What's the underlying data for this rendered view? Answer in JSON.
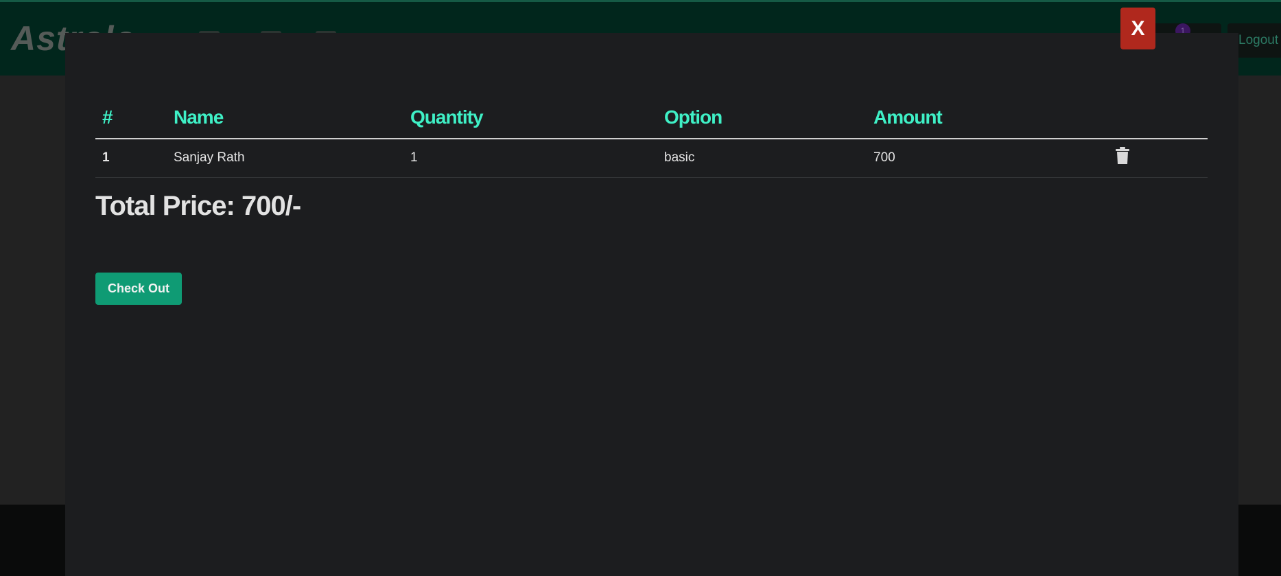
{
  "app": {
    "brand": "Astrolo",
    "cart_count": "1",
    "logout_label": "Logout"
  },
  "modal": {
    "close_label": "X",
    "table": {
      "headers": [
        "#",
        "Name",
        "Quantity",
        "Option",
        "Amount"
      ],
      "rows": [
        {
          "index": "1",
          "name": "Sanjay Rath",
          "quantity": "1",
          "option": "basic",
          "amount": "700"
        }
      ]
    },
    "total_price": "Total Price: 700/-",
    "checkout_label": "Check Out"
  },
  "colors": {
    "accent": "#3ff0c6",
    "button_green": "#0f9b74",
    "close_red": "#b0281d",
    "navbar": "#01261c"
  },
  "icons": {
    "delete": "trash-icon"
  }
}
